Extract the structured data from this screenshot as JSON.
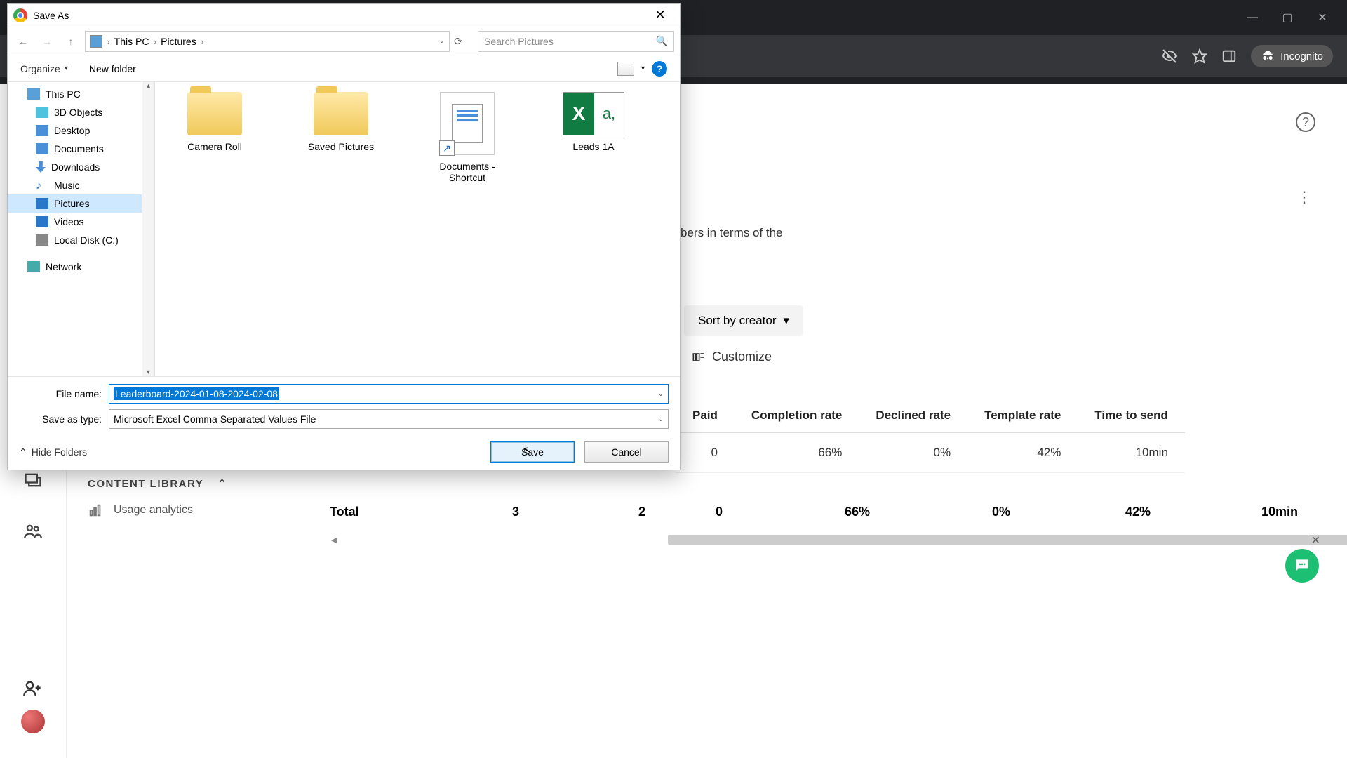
{
  "browser": {
    "incognito_label": "Incognito"
  },
  "background": {
    "partial_text": "bers in terms of the",
    "sort_label": "Sort by creator",
    "customize_label": "Customize"
  },
  "table": {
    "headers": [
      "Paid",
      "Completion rate",
      "Declined rate",
      "Template rate",
      "Time to send"
    ],
    "row": [
      "0",
      "66%",
      "0%",
      "42%",
      "10min"
    ],
    "total_label": "Total",
    "total_values": [
      "3",
      "2",
      "0",
      "66%",
      "0%",
      "42%",
      "10min"
    ]
  },
  "sidebar": {
    "content_library": "CONTENT LIBRARY",
    "usage_analytics": "Usage analytics"
  },
  "dialog": {
    "title": "Save As",
    "breadcrumb": {
      "root": "This PC",
      "folder": "Pictures"
    },
    "search_placeholder": "Search Pictures",
    "organize": "Organize",
    "new_folder": "New folder",
    "tree": {
      "this_pc": "This PC",
      "objects3d": "3D Objects",
      "desktop": "Desktop",
      "documents": "Documents",
      "downloads": "Downloads",
      "music": "Music",
      "pictures": "Pictures",
      "videos": "Videos",
      "local_disk": "Local Disk (C:)",
      "network": "Network"
    },
    "files": {
      "camera_roll": "Camera Roll",
      "saved_pictures": "Saved Pictures",
      "doc_shortcut": "Documents - Shortcut",
      "leads": "Leads 1A"
    },
    "filename_label": "File name:",
    "filename_value": "Leaderboard-2024-01-08-2024-02-08",
    "saveas_label": "Save as type:",
    "saveas_value": "Microsoft Excel Comma Separated Values File",
    "hide_folders": "Hide Folders",
    "save": "Save",
    "cancel": "Cancel"
  }
}
